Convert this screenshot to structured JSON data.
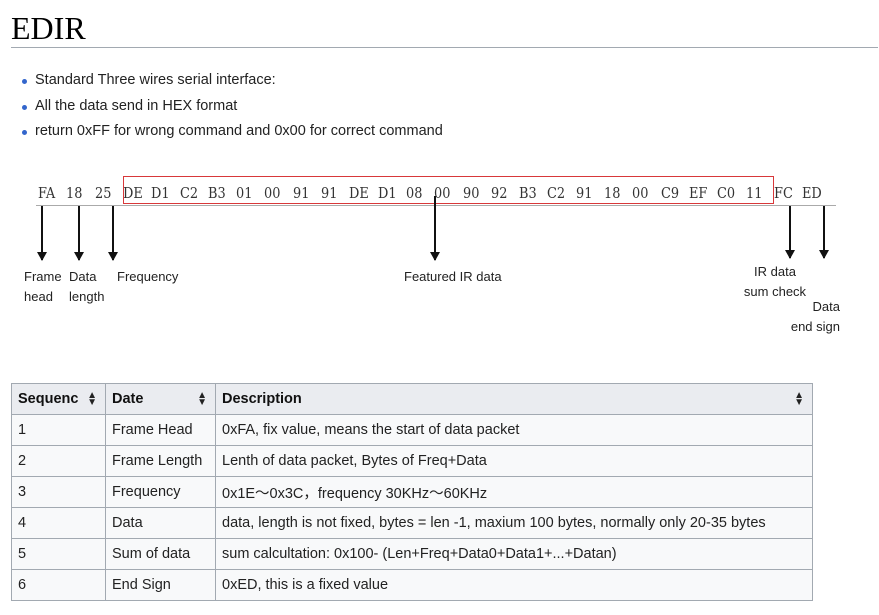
{
  "page": {
    "title": "EDIR",
    "bullets": [
      "Standard Three wires serial interface:",
      "All the data send in HEX format",
      "return 0xFF for wrong command and 0x00 for correct command"
    ]
  },
  "diagram": {
    "bytes": [
      "FA",
      "18",
      "25",
      "DE",
      "D1",
      "C2",
      "B3",
      "01",
      "00",
      "91",
      "91",
      "DE",
      "D1",
      "08",
      "00",
      "90",
      "92",
      "B3",
      "C2",
      "91",
      "18",
      "00",
      "C9",
      "EF",
      "C0",
      "11",
      "FC",
      "ED"
    ],
    "labels": {
      "frame_head_1": "Frame",
      "frame_head_2": "head",
      "data_length_1": "Data",
      "data_length_2": "length",
      "frequency": "Frequency",
      "featured": "Featured IR data",
      "sum_1": "IR data",
      "sum_2": "sum check",
      "end_1": "Data",
      "end_2": "end sign"
    },
    "highlight_color": "#d8383a"
  },
  "table": {
    "headers": [
      "Sequenc",
      "Date",
      "Description"
    ],
    "rows": [
      [
        "1",
        "Frame Head",
        "0xFA, fix value, means the start of data packet"
      ],
      [
        "2",
        "Frame Length",
        "Lenth of data packet, Bytes of Freq+Data"
      ],
      [
        "3",
        "Frequency",
        "0x1E～0x3C，frequency 30KHz～60KHz"
      ],
      [
        "4",
        "Data",
        "data, length is not fixed, bytes = len -1, maxium 100 bytes, normally only 20-35 bytes"
      ],
      [
        "5",
        "Sum of data",
        "sum calcultation: 0x100- (Len+Freq+Data0+Data1+...+Datan)"
      ],
      [
        "6",
        "End Sign",
        "0xED, this is a fixed value"
      ]
    ]
  },
  "icons": {
    "sort": "sort-arrows-icon",
    "bullet": "bullet-dot-icon"
  }
}
